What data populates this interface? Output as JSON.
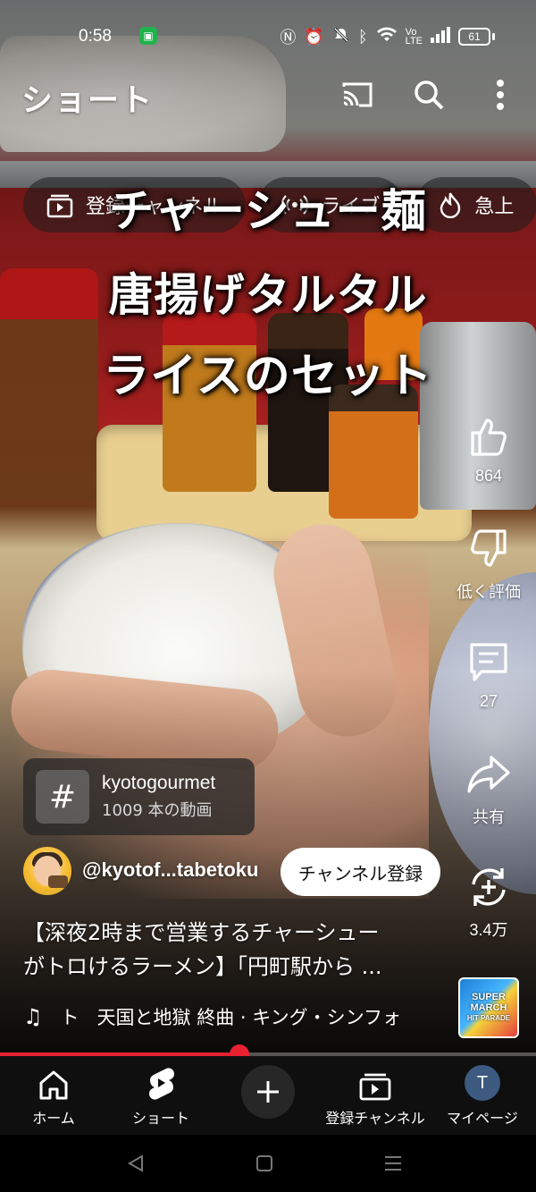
{
  "status_bar": {
    "time": "0:58",
    "battery": "61",
    "icons": [
      "nfc-icon",
      "alarm-icon",
      "mute-icon",
      "bluetooth-icon",
      "wifi-icon",
      "volte-icon",
      "signal-icon"
    ]
  },
  "header": {
    "title": "ショート",
    "icons": [
      "cast-icon",
      "search-icon",
      "more-vert-icon"
    ]
  },
  "chips": [
    {
      "label": "登録チャンネル",
      "icon": "subscriptions-icon"
    },
    {
      "label": "ライブ",
      "icon": "live-icon"
    },
    {
      "label": "急上",
      "icon": "trending-icon"
    }
  ],
  "overlay_caption": {
    "line1": "チャーシュー麺",
    "line2": "唐揚げタルタル",
    "line3": "ライスのセット"
  },
  "actions": {
    "like": {
      "icon": "thumb-up-icon",
      "label": "864"
    },
    "dislike": {
      "icon": "thumb-down-icon",
      "label": "低く評価"
    },
    "comments": {
      "icon": "comment-icon",
      "label": "27"
    },
    "share": {
      "icon": "share-icon",
      "label": "共有"
    },
    "remix": {
      "icon": "remix-icon",
      "label": "3.4万"
    }
  },
  "hashtag": {
    "symbol": "#",
    "name": "kyotogourmet",
    "count": "1009 本の動画"
  },
  "channel": {
    "handle": "@kyotof...tabetoku",
    "subscribe_label": "チャンネル登録"
  },
  "video": {
    "title_line1": "【深夜2時まで営業するチャーシュー",
    "title_line2": "がトロけるラーメン】「円町駅から ..."
  },
  "music": {
    "prefix": "ト",
    "track": "天国と地獄 終曲 · キング・シンフォ"
  },
  "album_art": {
    "line1": "SUPER",
    "line2": "MARCH",
    "line3": "HIT PARADE"
  },
  "progress": {
    "fraction": 0.447
  },
  "bottom_nav": [
    {
      "label": "ホーム",
      "icon": "home-icon"
    },
    {
      "label": "ショート",
      "icon": "shorts-icon"
    },
    {
      "label": "",
      "icon": "create-icon"
    },
    {
      "label": "登録チャンネル",
      "icon": "subscriptions-icon"
    },
    {
      "label": "マイページ",
      "icon": "avatar",
      "avatar_letter": "T"
    }
  ],
  "colors": {
    "accent_red": "#e8212f",
    "nav_bg": "#0f0f0f",
    "subscribe_bg": "#ffffff"
  }
}
